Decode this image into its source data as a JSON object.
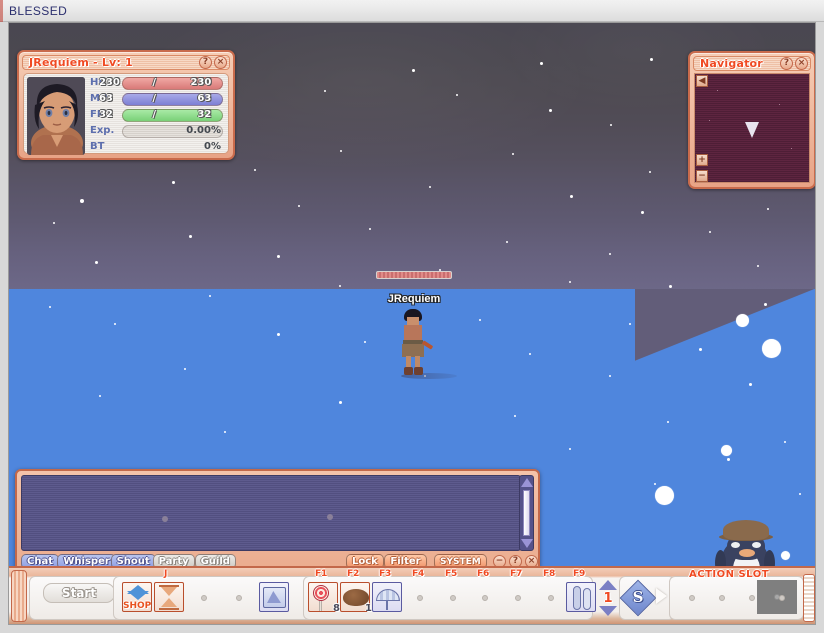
{
  "window": {
    "title": "BLESSED"
  },
  "status_panel": {
    "title": "JRequiem - Lv: 1",
    "help_label": "?",
    "close_label": "×",
    "rows": [
      {
        "label": "HP",
        "current": "230",
        "separator": "/",
        "max": "230",
        "type": "hp"
      },
      {
        "label": "MP",
        "current": "63",
        "separator": "/",
        "max": "63",
        "type": "mp"
      },
      {
        "label": "FP",
        "current": "32",
        "separator": "/",
        "max": "32",
        "type": "fp"
      },
      {
        "label": "Exp.",
        "value": "0.00%",
        "type": "exp"
      },
      {
        "label": "BT",
        "value": "0%",
        "type": "plain"
      }
    ],
    "colors": {
      "hp": "#d97a78",
      "mp": "#7c7fd4",
      "fp": "#79d078",
      "frame": "#c96b4c",
      "title_text": "#f04a22"
    }
  },
  "navigator": {
    "title": "Navigator",
    "help_label": "?",
    "close_label": "×",
    "collapse_label": "◀",
    "zoom_in_label": "+",
    "zoom_out_label": "−",
    "map_color": "#5e2540"
  },
  "world": {
    "player_name": "JRequiem",
    "sky_color": "#4a4751",
    "ground_color": "#4f86dd"
  },
  "chat": {
    "channel_buttons": [
      {
        "label": "Chat",
        "style": "blue"
      },
      {
        "label": "Whisper",
        "style": "blue"
      },
      {
        "label": "Shout",
        "style": "blue"
      },
      {
        "label": "Party",
        "style": "gray"
      },
      {
        "label": "Guild",
        "style": "gray"
      }
    ],
    "right_buttons": [
      {
        "label": "Lock",
        "style": "orange"
      },
      {
        "label": "Filter",
        "style": "orange"
      },
      {
        "label": "SYSTEM",
        "style": "system"
      }
    ],
    "minimize_label": "−",
    "help_label": "?",
    "close_label": "×",
    "input_value": "",
    "input_placeholder": ""
  },
  "taskbar": {
    "start_label": "Start",
    "quick_slots": [
      {
        "key": "",
        "icon": "shop-icon",
        "qty": ""
      },
      {
        "key": "J",
        "icon": "hourglass-icon",
        "qty": ""
      },
      {
        "key": "",
        "icon": "empty",
        "qty": ""
      },
      {
        "key": "",
        "icon": "empty",
        "qty": ""
      },
      {
        "key": "",
        "icon": "scroll-icon",
        "qty": ""
      }
    ],
    "fkey_slots": [
      {
        "key": "F1",
        "icon": "lollipop-icon",
        "qty": "8"
      },
      {
        "key": "F2",
        "icon": "bread-icon",
        "qty": "1"
      },
      {
        "key": "F3",
        "icon": "umbrella-icon",
        "qty": ""
      },
      {
        "key": "F4",
        "icon": "empty",
        "qty": ""
      },
      {
        "key": "F5",
        "icon": "empty",
        "qty": ""
      },
      {
        "key": "F6",
        "icon": "empty",
        "qty": ""
      },
      {
        "key": "F7",
        "icon": "empty",
        "qty": ""
      },
      {
        "key": "F8",
        "icon": "empty",
        "qty": ""
      },
      {
        "key": "F9",
        "icon": "people-icon",
        "qty": ""
      }
    ],
    "page_number": "1",
    "skill_icon_label": "S",
    "action_slot_label": "ACTION SLOT",
    "action_slots": [
      {
        "icon": "empty"
      },
      {
        "icon": "empty"
      },
      {
        "icon": "empty"
      },
      {
        "icon": "empty"
      }
    ]
  }
}
